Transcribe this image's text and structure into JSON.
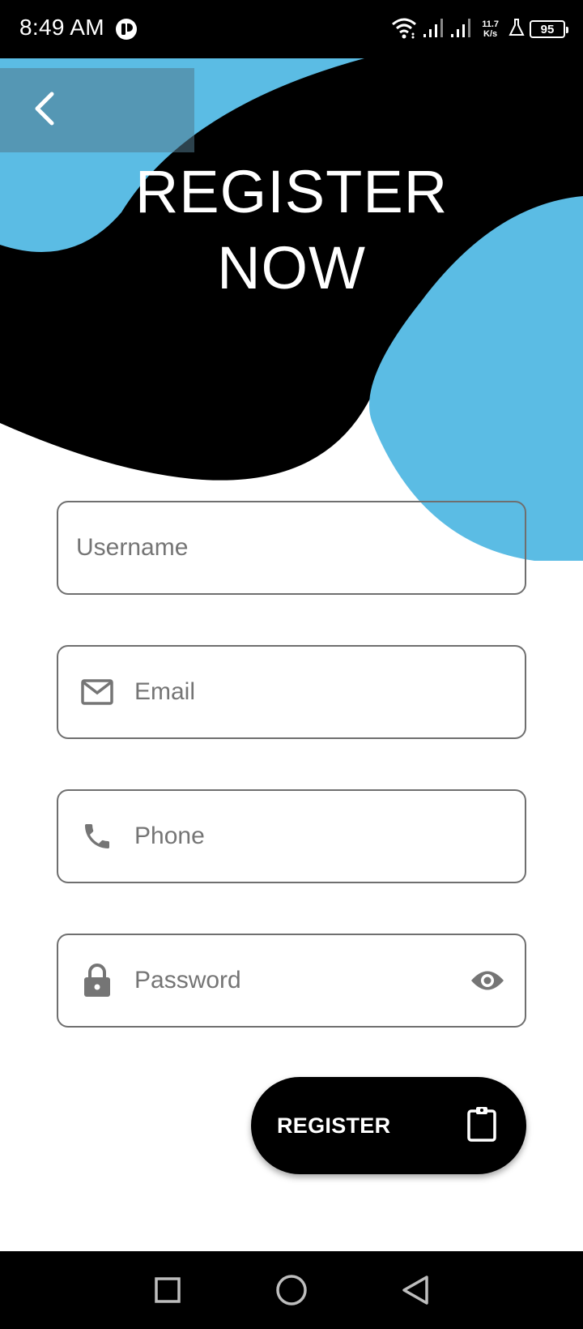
{
  "status_bar": {
    "time": "8:49 AM",
    "net_speed_value": "11.7",
    "net_speed_unit": "K/s",
    "battery": "95",
    "icons": [
      "app-indicator-icon",
      "wifi-icon",
      "signal-icon",
      "signal-icon",
      "lab-icon",
      "battery-icon"
    ]
  },
  "header": {
    "back_icon": "chevron-left-icon",
    "title_line1": "REGISTER",
    "title_line2": "NOW"
  },
  "form": {
    "username_placeholder": "Username",
    "username_value": "",
    "email_placeholder": "Email",
    "email_value": "",
    "email_icon": "mail-icon",
    "phone_placeholder": "Phone",
    "phone_value": "",
    "phone_icon": "phone-icon",
    "password_placeholder": "Password",
    "password_value": "",
    "password_icon": "lock-icon",
    "password_toggle_icon": "eye-icon"
  },
  "register_button": {
    "label": "REGISTER",
    "icon": "clipboard-icon"
  },
  "nav_bar": {
    "buttons": [
      "recents-icon",
      "home-icon",
      "back-icon"
    ]
  },
  "colors": {
    "accent_blue": "#5bbce4",
    "header_black": "#000000",
    "border_gray": "#6f6f6f",
    "icon_gray": "#757575"
  }
}
